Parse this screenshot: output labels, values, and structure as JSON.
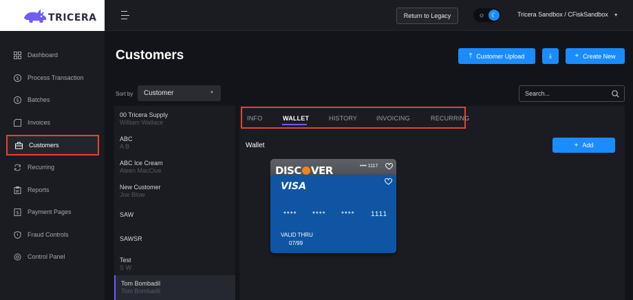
{
  "brand": {
    "name": "TRICERA"
  },
  "topbar": {
    "legacy_label": "Return to Legacy",
    "account_label": "Tricera Sandbox / CFiskSandbox"
  },
  "sidebar": {
    "items": [
      {
        "label": "Dashboard",
        "icon": "grid-icon"
      },
      {
        "label": "Process Transaction",
        "icon": "dollar-circle-icon"
      },
      {
        "label": "Batches",
        "icon": "dollar-circle-icon"
      },
      {
        "label": "Invoices",
        "icon": "document-icon"
      },
      {
        "label": "Customers",
        "icon": "briefcase-icon",
        "active": true
      },
      {
        "label": "Recurring",
        "icon": "refresh-icon"
      },
      {
        "label": "Reports",
        "icon": "clipboard-icon"
      },
      {
        "label": "Payment Pages",
        "icon": "dollar-page-icon"
      },
      {
        "label": "Fraud Controls",
        "icon": "shield-icon"
      },
      {
        "label": "Control Panel",
        "icon": "settings-icon"
      }
    ]
  },
  "header": {
    "title": "Customers",
    "upload_label": "Customer Upload",
    "create_label": "Create New"
  },
  "sort": {
    "label": "Sort by",
    "value": "Customer"
  },
  "search": {
    "placeholder": "Search..."
  },
  "customers": [
    {
      "name": "00 Tricera Supply",
      "contact": "William Wallace"
    },
    {
      "name": "ABC",
      "contact": "A B"
    },
    {
      "name": "ABC Ice Cream",
      "contact": "Aleen MacCive"
    },
    {
      "name": "New Customer",
      "contact": "Joe Blow"
    },
    {
      "name": "SAW",
      "contact": ""
    },
    {
      "name": "SAWSR",
      "contact": ""
    },
    {
      "name": "Test",
      "contact": "S W"
    },
    {
      "name": "Tom Bombadil",
      "contact": "Tom Bombadil",
      "selected": true
    }
  ],
  "tabs": [
    "INFO",
    "WALLET",
    "HISTORY",
    "INVOICING",
    "RECURRING"
  ],
  "active_tab": "WALLET",
  "wallet": {
    "title": "Wallet",
    "add_label": "Add",
    "cards": [
      {
        "brand": "DISCOVER",
        "last4": "•••• 1117"
      },
      {
        "brand": "VISA",
        "digits": [
          "****",
          "****",
          "****",
          "1111"
        ],
        "valid_label": "VALID THRU",
        "expiry": "07/99"
      }
    ]
  },
  "colors": {
    "accent": "#1a8cff",
    "highlight": "#e8432b",
    "tab_underline": "#6d5dfc",
    "visa_card": "#0f55a4"
  }
}
